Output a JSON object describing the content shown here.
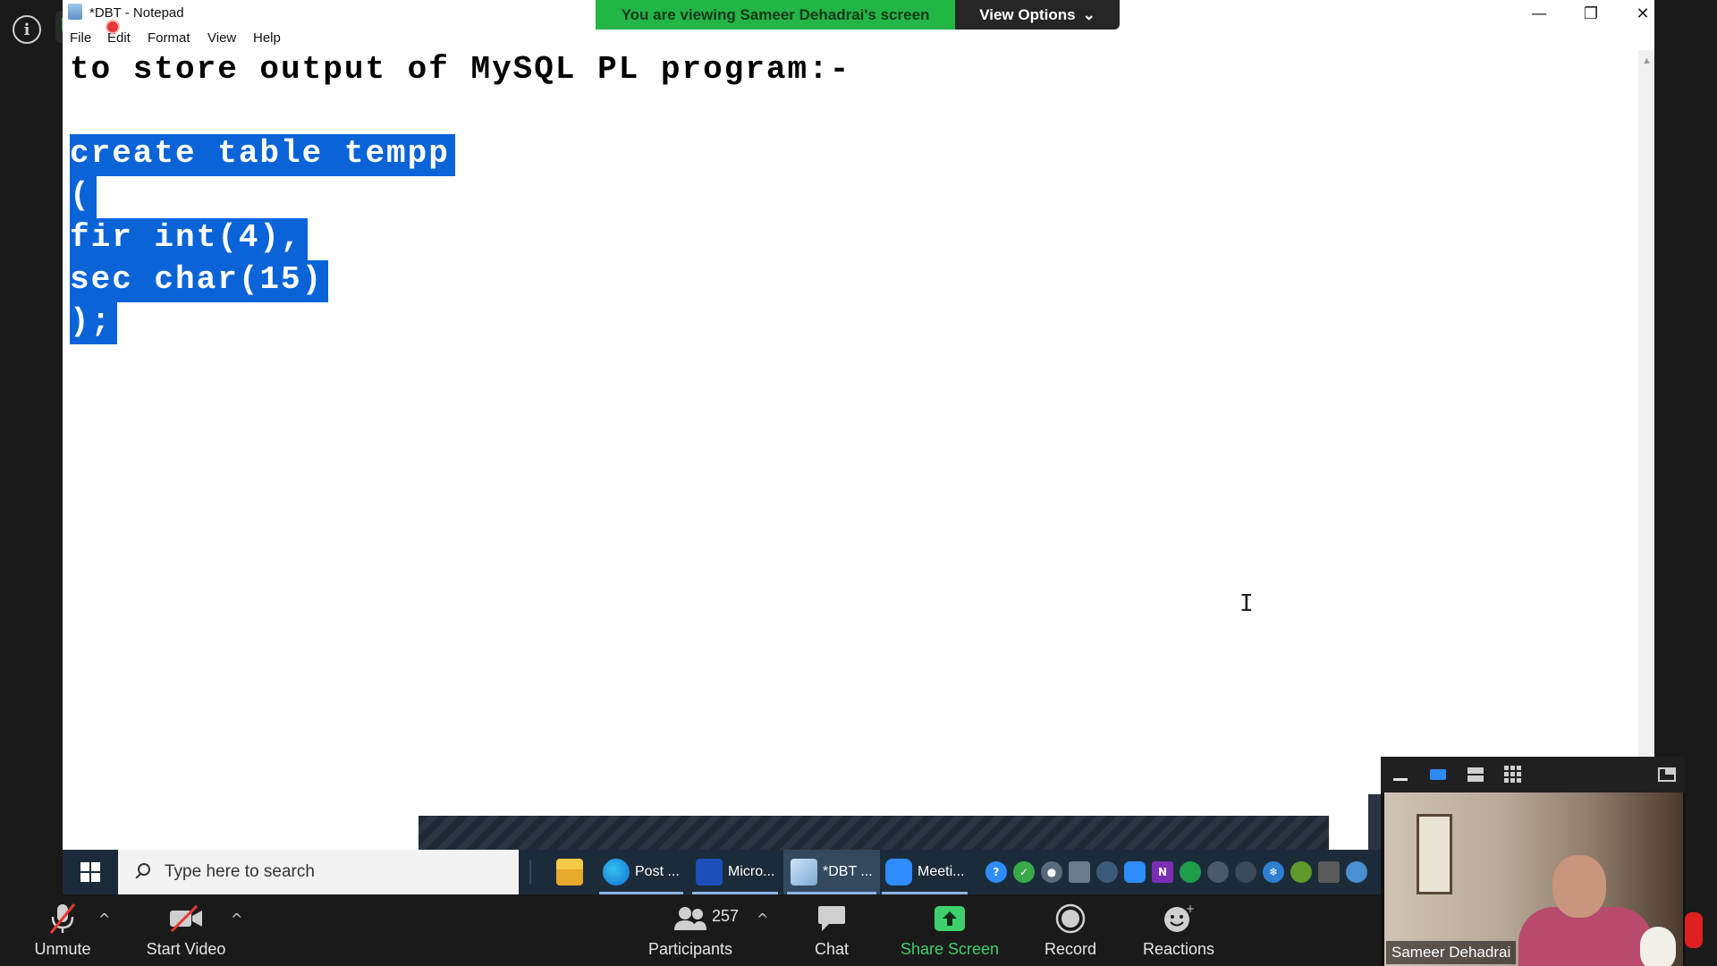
{
  "zoom": {
    "banner_text": "You are viewing Sameer Dehadrai's screen",
    "view_options_label": "View Options",
    "toolbar": {
      "unmute": "Unmute",
      "start_video": "Start Video",
      "participants": "Participants",
      "participant_count": "257",
      "chat": "Chat",
      "share_screen": "Share Screen",
      "record": "Record",
      "reactions": "Reactions"
    },
    "video_name": "Sameer Dehadrai",
    "colors": {
      "banner_green": "#23b545",
      "share_green": "#3ed06c"
    }
  },
  "notepad": {
    "title": "*DBT - Notepad",
    "menu": [
      "File",
      "Edit",
      "Format",
      "View",
      "Help"
    ],
    "lines": [
      "to store output of MySQL PL program:-",
      "",
      "create table tempp",
      "(",
      "fir int(4),",
      "sec char(15)",
      ");"
    ],
    "selection_color": "#0a64d8"
  },
  "taskbar": {
    "search_placeholder": "Type here to search",
    "apps": [
      "Post ...",
      "Micro...",
      "*DBT ...",
      "Meeti..."
    ]
  }
}
